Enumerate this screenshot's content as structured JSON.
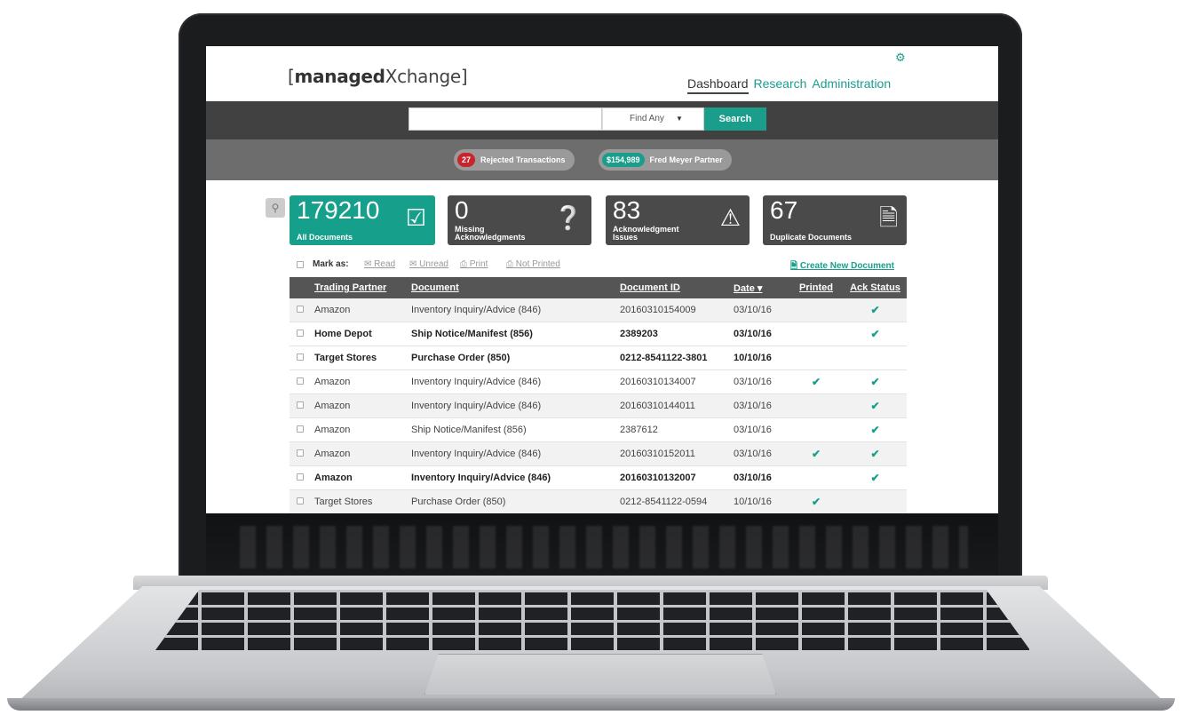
{
  "app": {
    "logo_prefix": "[",
    "logo_bold": "managed",
    "logo_rest": "Xchange]",
    "nav": [
      "Dashboard",
      "Research",
      "Administration"
    ]
  },
  "search": {
    "value": "",
    "find_label": "Find Any",
    "button": "Search"
  },
  "alerts": {
    "rejected_count": "27",
    "rejected_label": "Rejected Transactions",
    "partner_amount": "$154,989",
    "partner_label": "Fred Meyer Partner"
  },
  "tiles": [
    {
      "num": "179210",
      "label": "All Documents",
      "icon": "check-icon"
    },
    {
      "num": "0",
      "label": "Missing Acknowledgments",
      "icon": "question-icon"
    },
    {
      "num": "83",
      "label": "Acknowledgment Issues",
      "icon": "warning-icon"
    },
    {
      "num": "67",
      "label": "Duplicate Documents",
      "icon": "document-icon"
    }
  ],
  "toolbar": {
    "mark_as": "Mark as:",
    "read": "Read",
    "unread": "Unread",
    "print": "Print",
    "not_printed": "Not Printed",
    "create": "Create New Document"
  },
  "table": {
    "headers": [
      "Trading Partner",
      "Document",
      "Document ID",
      "Date ▾",
      "Printed",
      "Ack Status"
    ],
    "rows": [
      {
        "partner": "Amazon",
        "doc": "Inventory Inquiry/Advice (846)",
        "id": "20160310154009",
        "date": "03/10/16",
        "printed": "",
        "ack": "✔"
      },
      {
        "partner": "Home Depot",
        "doc": "Ship Notice/Manifest (856)",
        "id": "2389203",
        "date": "03/10/16",
        "printed": "",
        "ack": "✔"
      },
      {
        "partner": "Target Stores",
        "doc": "Purchase Order (850)",
        "id": "0212-8541122-3801",
        "date": "10/10/16",
        "printed": "",
        "ack": ""
      },
      {
        "partner": "Amazon",
        "doc": "Inventory Inquiry/Advice (846)",
        "id": "20160310134007",
        "date": "03/10/16",
        "printed": "✔",
        "ack": "✔"
      },
      {
        "partner": "Amazon",
        "doc": "Inventory Inquiry/Advice (846)",
        "id": "20160310144011",
        "date": "03/10/16",
        "printed": "",
        "ack": "✔"
      },
      {
        "partner": "Amazon",
        "doc": "Ship Notice/Manifest (856)",
        "id": "2387612",
        "date": "03/10/16",
        "printed": "",
        "ack": "✔"
      },
      {
        "partner": "Amazon",
        "doc": "Inventory Inquiry/Advice (846)",
        "id": "20160310152011",
        "date": "03/10/16",
        "printed": "✔",
        "ack": "✔"
      },
      {
        "partner": "Amazon",
        "doc": "Inventory Inquiry/Advice (846)",
        "id": "20160310132007",
        "date": "03/10/16",
        "printed": "",
        "ack": "✔"
      },
      {
        "partner": "Target Stores",
        "doc": "Purchase Order (850)",
        "id": "0212-8541122-0594",
        "date": "10/10/16",
        "printed": "✔",
        "ack": ""
      }
    ]
  },
  "colors": {
    "accent": "#1a9e8b",
    "dark": "#414141",
    "alert": "#c9242b"
  }
}
